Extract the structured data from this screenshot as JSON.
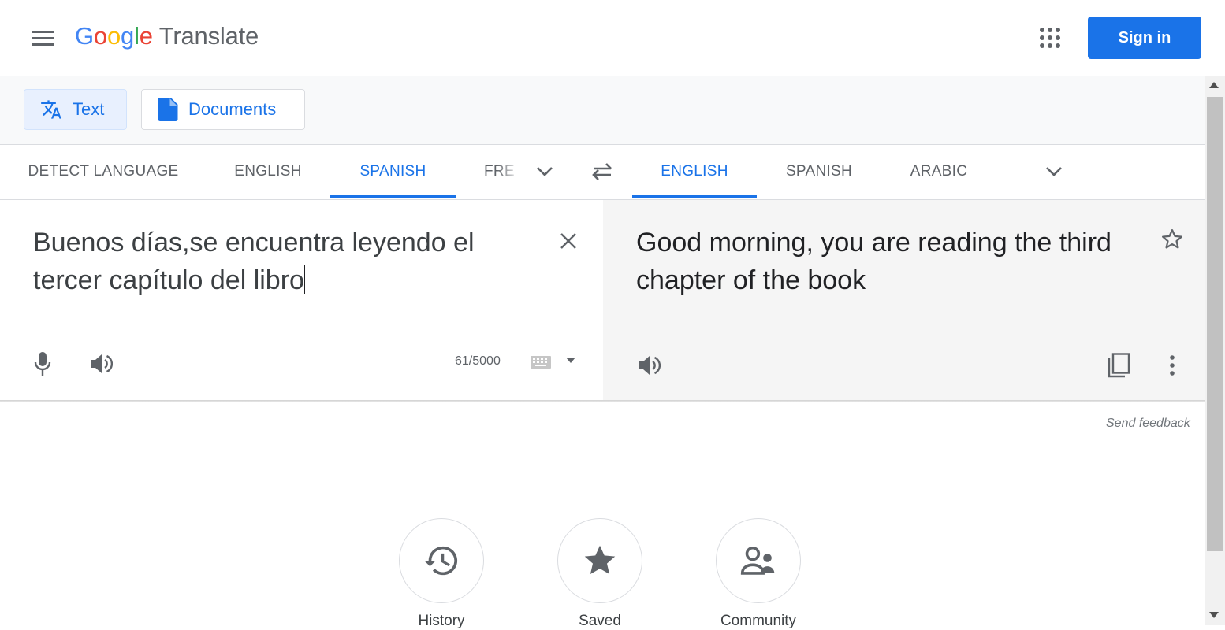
{
  "header": {
    "logo_letters": [
      "G",
      "o",
      "o",
      "g",
      "l",
      "e"
    ],
    "product": "Translate",
    "signin_label": "Sign in"
  },
  "modes": {
    "text_label": "Text",
    "documents_label": "Documents"
  },
  "source_languages": [
    "DETECT LANGUAGE",
    "ENGLISH",
    "SPANISH",
    "FRE"
  ],
  "source_active": "SPANISH",
  "target_languages": [
    "ENGLISH",
    "SPANISH",
    "ARABIC"
  ],
  "target_active": "ENGLISH",
  "source": {
    "text": "Buenos días,se encuentra leyendo el tercer capítulo del libro",
    "char_count": "61/5000"
  },
  "target": {
    "text": "Good morning, you are reading the third chapter of the book"
  },
  "feedback_label": "Send feedback",
  "bottom_actions": [
    {
      "label": "History",
      "icon": "history-icon"
    },
    {
      "label": "Saved",
      "icon": "star-icon"
    },
    {
      "label": "Community",
      "icon": "community-icon"
    }
  ],
  "colors": {
    "accent": "#1a73e8",
    "accent_light": "#e8f0fe",
    "text_secondary": "#5f6368",
    "target_panel_bg": "#f5f5f5"
  }
}
